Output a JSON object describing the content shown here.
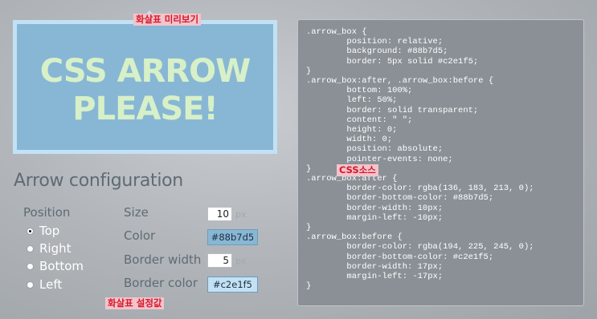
{
  "preview": {
    "line1": "CSS ARROW",
    "line2": "PLEASE!",
    "annotation": "화살표 미리보기"
  },
  "config": {
    "heading": "Arrow configuration",
    "position_label": "Position",
    "positions": [
      {
        "label": "Top",
        "checked": true
      },
      {
        "label": "Right",
        "checked": false
      },
      {
        "label": "Bottom",
        "checked": false
      },
      {
        "label": "Left",
        "checked": false
      }
    ],
    "size_label": "Size",
    "size_value": "10",
    "size_unit": "px",
    "color_label": "Color",
    "color_value": "#88b7d5",
    "border_width_label": "Border width",
    "border_width_value": "5",
    "border_width_unit": "px",
    "border_color_label": "Border color",
    "border_color_value": "#c2e1f5",
    "annotation": "화살표 설정값"
  },
  "code": {
    "annotation": "CSS소스",
    "part1": ".arrow_box {\n        position: relative;\n        background: #88b7d5;\n        border: 5px solid #c2e1f5;\n}\n.arrow_box:after, .arrow_box:before {\n        bottom: 100%;\n        left: 50%;\n        border: solid transparent;\n        content: \" \";\n        height: 0;\n        width: 0;\n        position: absolute;\n        pointer-events: none;\n}",
    "part2": "\n.arrow_box:after {\n        border-color: rgba(136, 183, 213, 0);\n        border-bottom-color: #88b7d5;\n        border-width: 10px;\n        margin-left: -10px;\n}\n.arrow_box:before {\n        border-color: rgba(194, 225, 245, 0);\n        border-bottom-color: #c2e1f5;\n        border-width: 17px;\n        margin-left: -17px;\n}"
  },
  "colors": {
    "arrow_background": "#88b7d5",
    "arrow_border": "#c2e1f5",
    "preview_text": "#d7f0c8",
    "annotation_text": "#d8182a",
    "annotation_bg": "#f2c4cc",
    "code_panel_bg": "#8a9096"
  }
}
